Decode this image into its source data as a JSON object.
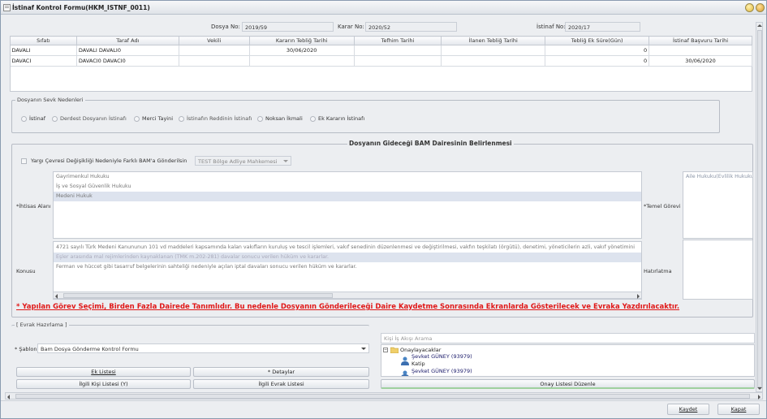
{
  "window": {
    "title": "İstinaf Kontrol Formu(HKM_ISTNF_0011)"
  },
  "fields": {
    "dosya_no": {
      "label": "Dosya No:",
      "value": "2019/59"
    },
    "karar_no": {
      "label": "Karar No:",
      "value": "2020/52"
    },
    "istinaf_no": {
      "label": "İstinaf No:",
      "value": "2020/17"
    }
  },
  "parties_table": {
    "headers": [
      "Sıfatı",
      "Taraf Adı",
      "Vekili",
      "Kararın Tebliğ Tarihi",
      "Tefhim Tarihi",
      "İlanen Tebliğ Tarihi",
      "Tebliğ Ek Süre(Gün)",
      "İstinaf Başvuru Tarihi"
    ],
    "rows": [
      [
        "DAVALI",
        "DAVALI DAVALI0",
        "",
        "30/06/2020",
        "",
        "",
        "0",
        ""
      ],
      [
        "DAVACI",
        "DAVACI0 DAVACI0",
        "",
        "",
        "",
        "",
        "0",
        "30/06/2020"
      ]
    ]
  },
  "sevk": {
    "title": "Dosyanın Sevk Nedenleri",
    "options": [
      "İstinaf",
      "Derdest Dosyanın İstinafı",
      "Merci Tayini",
      "İstinafın Reddinin İstinafı",
      "Noksan İkmali",
      "Ek Kararın İstinafı"
    ]
  },
  "bam": {
    "title": "Dosyanın Gideceği BAM Dairesinin Belirlenmesi",
    "yargi_checkbox": "Yargı Çevresi Değişikliği Nedeniyle Farklı BAM'a Gönderilsin",
    "yargi_select": "TEST Bölge Adliye Mahkemesi",
    "ihtisas_label": "*İhtisas Alanı",
    "ihtisas_items": [
      "Gayrimenkul Hukuku",
      "İş ve Sosyal Güvenlik Hukuku",
      "Medeni Hukuk"
    ],
    "temel_label": "*Temel Görevi",
    "temel_items": [
      "Aile Hukuku(Evlilik Hukuku"
    ],
    "konusu_label": "Konusu",
    "konusu_items": [
      "4721 sayılı Türk Medeni Kanununun 101 vd maddeleri kapsamında kalan vakıfların kuruluş ve tescil işlemleri, vakıf senedinin düzenlenmesi ve değiştirilmesi, vakfın teşkilatı (örgütü), denetimi, yöneticilerin azli, vakıf yönetimini",
      "Eşler arasında mal rejimlerinden kaynaklanan (TMK m.202-281) davalar sonucu verilen hüküm ve kararlar.",
      "Ferman ve hüccet gibi tasarruf belgelerinin sahteliği nedeniyle açılan iptal davaları sonucu verilen hüküm ve kararlar."
    ],
    "hatirlatma_label": "Hatırlatma"
  },
  "warning": "* Yapılan Görev Seçimi, Birden Fazla Dairede Tanımlıdır. Bu nedenle Dosyanın Gönderileceği Daire Kaydetme Sonrasında Ekranlarda Gösterilecek ve Evraka Yazdırılacaktır.",
  "evrak": {
    "title": "Evrak Hazırlama",
    "sablon_label": "* Şablon",
    "sablon_value": "Bam Dosya Gönderme Kontrol  Formu",
    "buttons": [
      "Ek Listesi",
      "* Detaylar",
      "İlgili Kişi Listesi (Y)",
      "İlgili Evrak Listesi"
    ]
  },
  "kisi": {
    "search_placeholder": "Kişi İş Akışı Arama",
    "root": "Onaylayacaklar",
    "nodes": [
      "Şevket GÜNEY (93979)",
      "Katip",
      "Şevket GÜNEY (93979)"
    ],
    "onay_button": "Onay Listesi Düzenle"
  },
  "footer": {
    "save": "Kaydet",
    "close": "Kapat"
  }
}
